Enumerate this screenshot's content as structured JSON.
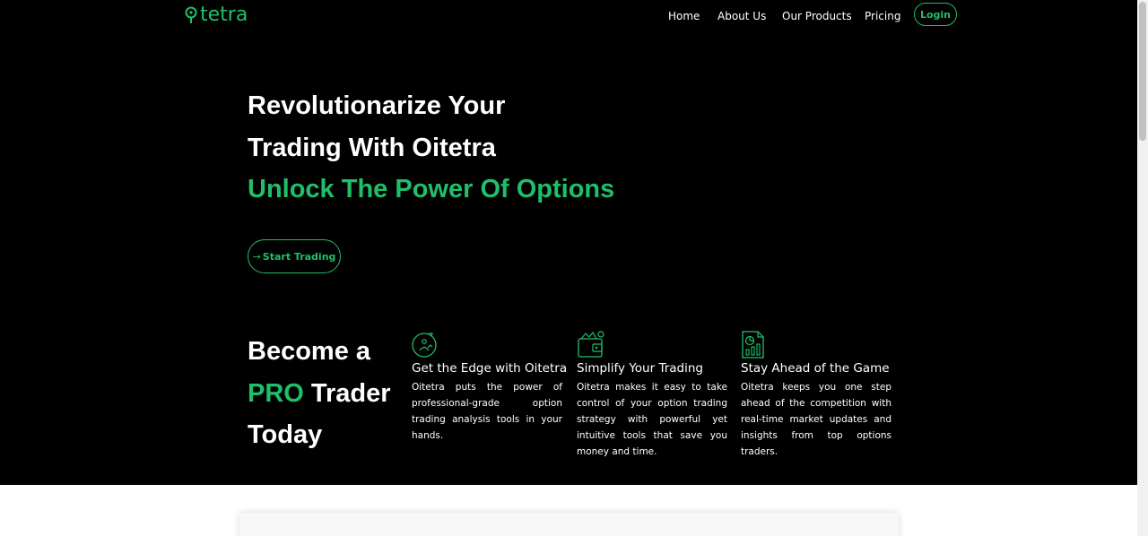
{
  "brand": {
    "logo_text": "tetra",
    "accent": "#1fbf6a",
    "background": "#000000"
  },
  "nav": {
    "items": [
      "Home",
      "About Us",
      "Our Products",
      "Pricing"
    ],
    "login_label": "Login"
  },
  "hero": {
    "line1": "Revolutionarize Your",
    "line2": "Trading With Oitetra",
    "line3": "Unlock The Power Of Options",
    "cta_arrow": "→",
    "cta_label": "Start Trading"
  },
  "pro": {
    "line1": "Become a",
    "line2_green": "PRO",
    "line2_rest": " Trader",
    "line3": "Today"
  },
  "features": [
    {
      "icon": "chart-cycle-icon",
      "title": "Get the Edge with Oitetra",
      "desc": "Oitetra puts the power of professional-grade option trading analysis tools in your hands."
    },
    {
      "icon": "wallet-icon",
      "title": "Simplify Your Trading",
      "desc": "Oitetra makes it easy to take control of your option trading strategy with powerful yet intuitive tools that save you money and time."
    },
    {
      "icon": "report-document-icon",
      "title": "Stay Ahead of the Game",
      "desc": "Oitetra keeps you one step ahead of the competition with real-time market updates and insights from top options traders."
    }
  ]
}
